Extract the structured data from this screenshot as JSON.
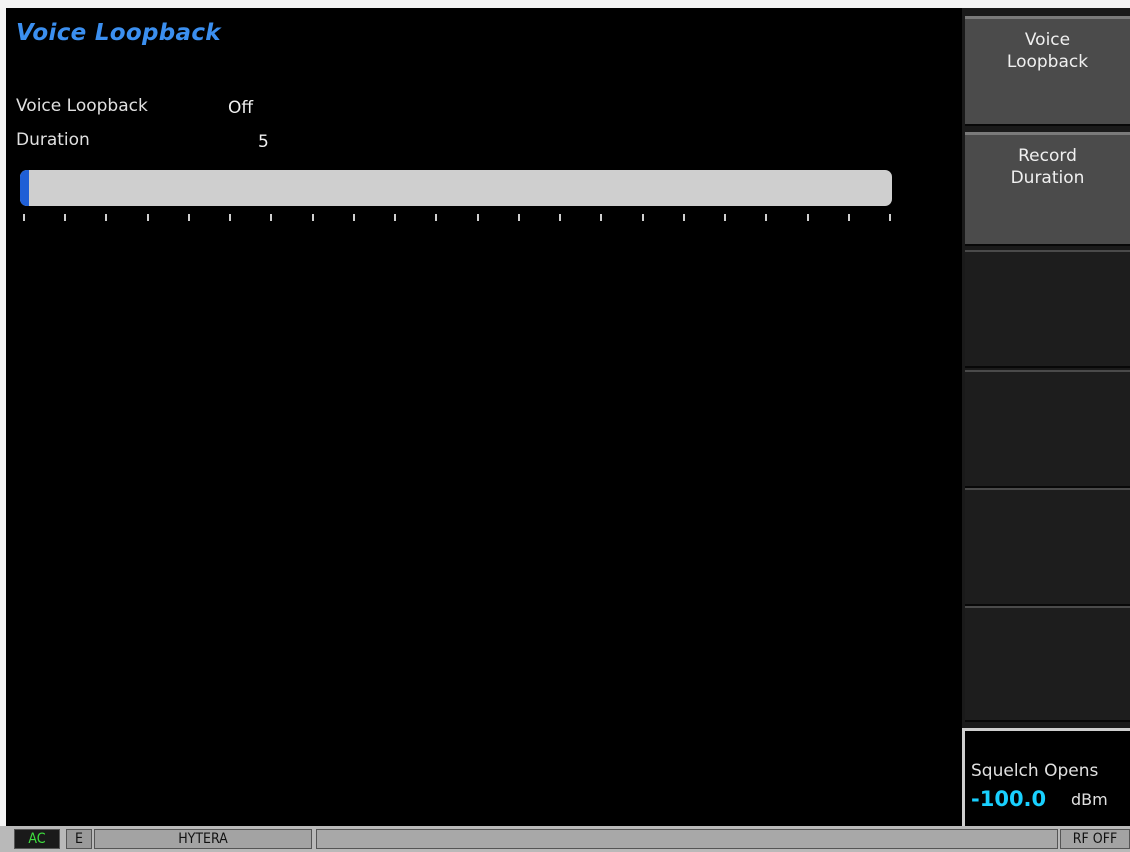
{
  "screen": {
    "title": "Voice Loopback",
    "params": [
      {
        "label": "Voice Loopback",
        "value": "Off"
      },
      {
        "label": "Duration",
        "value": "5"
      }
    ],
    "progress": {
      "fraction": 0.01,
      "fill_color": "#1f5fd6",
      "track_color": "#cfcfcf",
      "tick_count": 22
    }
  },
  "softkeys": [
    {
      "label": "Voice\nLoopback",
      "active": true
    },
    {
      "label": "Record\nDuration",
      "active": true
    },
    {
      "label": "",
      "active": false
    },
    {
      "label": "",
      "active": false
    },
    {
      "label": "",
      "active": false
    },
    {
      "label": "",
      "active": false
    }
  ],
  "squelch": {
    "label": "Squelch Opens",
    "value": "-100.0",
    "unit": "dBm",
    "value_color": "#19d0ff"
  },
  "statusbar": {
    "ac": "AC",
    "ext": "E",
    "profile": "HYTERA",
    "message": "",
    "rf": "RF OFF"
  },
  "colors": {
    "title": "#3b8ff0",
    "background": "#000000"
  }
}
